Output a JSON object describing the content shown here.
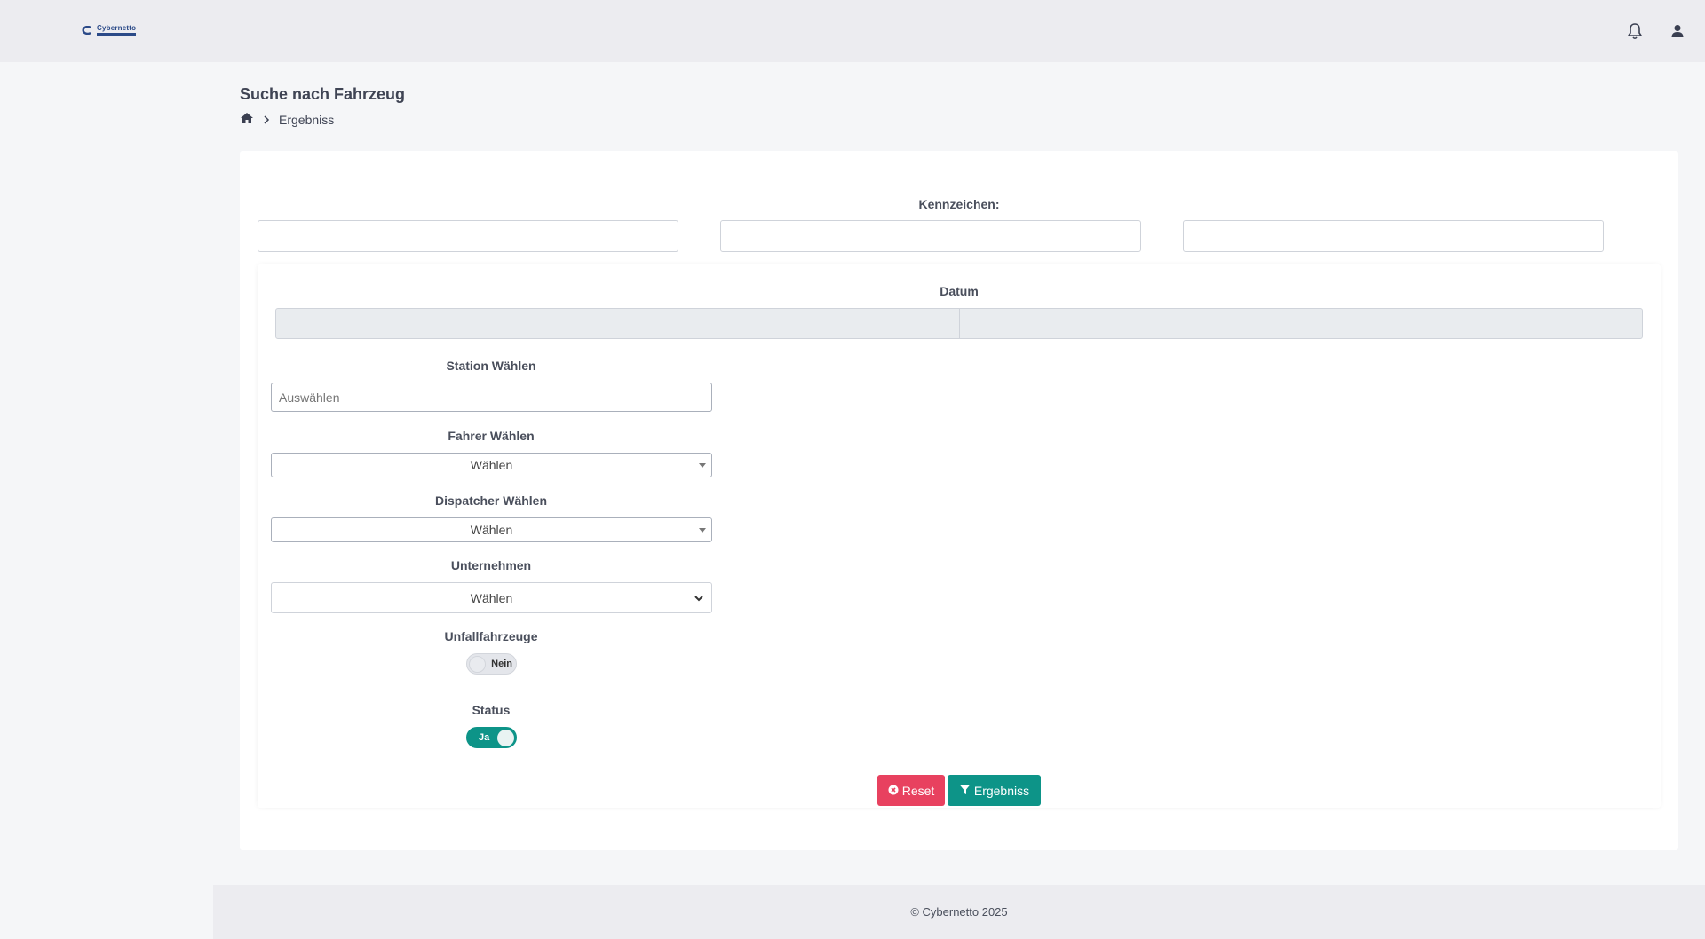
{
  "header": {
    "logo_text": "Cybernetto",
    "bell_icon": "bell-icon",
    "user_icon": "user-icon"
  },
  "page": {
    "title": "Suche nach Fahrzeug",
    "breadcrumb_current": "Ergebniss"
  },
  "form": {
    "kennzeichen_label": "Kennzeichen:",
    "kennzeichen_values": [
      "",
      "",
      ""
    ],
    "datum_label": "Datum",
    "station_label": "Station Wählen",
    "station_placeholder": "Auswählen",
    "fahrer_label": "Fahrer Wählen",
    "fahrer_value": "Wählen",
    "dispatcher_label": "Dispatcher Wählen",
    "dispatcher_value": "Wählen",
    "unternehmen_label": "Unternehmen",
    "unternehmen_value": "Wählen",
    "unfall_label": "Unfallfahrzeuge",
    "unfall_toggle": "Nein",
    "status_label": "Status",
    "status_toggle": "Ja",
    "reset_label": "Reset",
    "result_label": "Ergebniss"
  },
  "colors": {
    "accent": "#0d9488",
    "danger": "#e8415f"
  },
  "footer": {
    "copyright": "© Cybernetto 2025"
  }
}
